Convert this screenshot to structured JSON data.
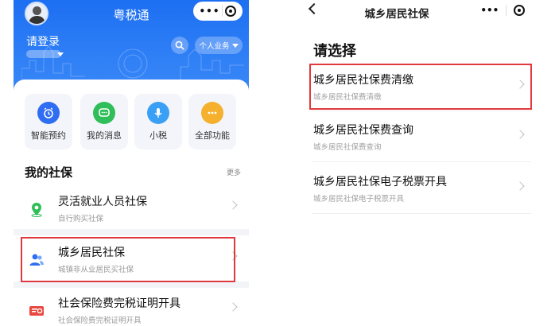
{
  "left": {
    "app_title": "粤税通",
    "login_label": "请登录",
    "business_button": "个人业务",
    "quick_actions": [
      {
        "label": "智能预约",
        "icon": "alarm-clock-icon",
        "color": "#2f6df2"
      },
      {
        "label": "我的消息",
        "icon": "message-icon",
        "color": "#2fbe5a"
      },
      {
        "label": "小税",
        "icon": "microphone-icon",
        "color": "#3aa0f5"
      },
      {
        "label": "全部功能",
        "icon": "more-dots-icon",
        "color": "#f5b02e"
      }
    ],
    "section_title": "我的社保",
    "more_label": "更多",
    "items": [
      {
        "title": "灵活就业人员社保",
        "subtitle": "自行购买社保",
        "icon": "location-pin-icon"
      },
      {
        "title": "城乡居民社保",
        "subtitle": "城镇非从业居民买社保",
        "icon": "people-icon"
      },
      {
        "title": "社会保险费完税证明开具",
        "subtitle": "社会保险费完税证明开具",
        "icon": "certificate-icon"
      }
    ]
  },
  "right": {
    "nav_title": "城乡居民社保",
    "heading": "请选择",
    "options": [
      {
        "title": "城乡居民社保费清缴",
        "subtitle": "城乡居民社保费清缴"
      },
      {
        "title": "城乡居民社保费查询",
        "subtitle": "城乡居民社保费查询"
      },
      {
        "title": "城乡居民社保电子税票开具",
        "subtitle": "城乡居民社保电子税票开具"
      }
    ]
  },
  "colors": {
    "brand_blue": "#1d6ff2",
    "highlight_red": "#e0393e"
  }
}
